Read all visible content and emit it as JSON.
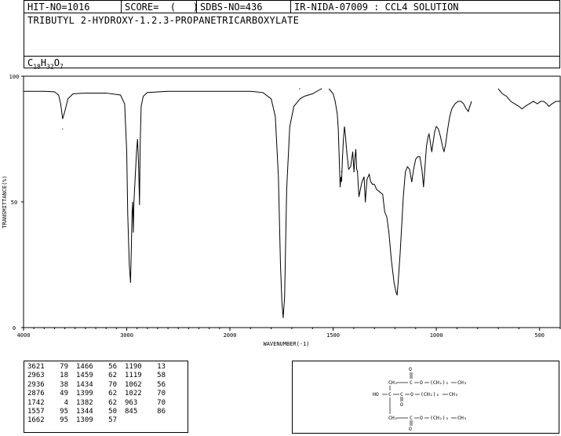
{
  "header": {
    "hit": "HIT-NO=1016",
    "score": "SCORE=  (   )",
    "sdbs": "SDBS-NO=436",
    "ir": "IR-NIDA-07009 : CCL4 SOLUTION"
  },
  "compound_name": "TRIBUTYL 2-HYDROXY-1.2.3-PROPANETRICARBOXYLATE",
  "formula": {
    "c": "C",
    "c_sub": "18",
    "h": "H",
    "h_sub": "32",
    "o": "O",
    "o_sub": "7"
  },
  "chart_data": {
    "type": "line",
    "xlabel": "WAVENUMBER(-1)",
    "ylabel": "TRANSMITTANCE(%)",
    "xlim": [
      4000,
      400
    ],
    "ylim": [
      0,
      100
    ],
    "x_ticks": [
      "4000",
      "3000",
      "2000",
      "1500",
      "1000",
      "500"
    ],
    "y_ticks": [
      "100",
      "50",
      "0"
    ],
    "series": [
      {
        "segments": [
          [
            [
              4000,
              94
            ],
            [
              3800,
              94
            ],
            [
              3700,
              93.8
            ],
            [
              3660,
              92.5
            ],
            [
              3640,
              89
            ],
            [
              3621,
              83
            ],
            [
              3600,
              86
            ],
            [
              3570,
              91
            ],
            [
              3520,
              93
            ],
            [
              3400,
              93.3
            ],
            [
              3200,
              93.3
            ],
            [
              3060,
              92.5
            ],
            [
              3020,
              89
            ],
            [
              3000,
              70
            ],
            [
              2990,
              45
            ],
            [
              2975,
              25
            ],
            [
              2963,
              18
            ],
            [
              2955,
              32
            ],
            [
              2948,
              46
            ],
            [
              2942,
              50
            ],
            [
              2936,
              38
            ],
            [
              2930,
              50
            ],
            [
              2915,
              62
            ],
            [
              2905,
              70
            ],
            [
              2895,
              75
            ],
            [
              2885,
              65
            ],
            [
              2876,
              49
            ],
            [
              2870,
              72
            ],
            [
              2860,
              88
            ],
            [
              2840,
              92
            ],
            [
              2800,
              93.5
            ],
            [
              2600,
              94
            ],
            [
              2200,
              94
            ],
            [
              1900,
              94
            ],
            [
              1840,
              93.5
            ],
            [
              1800,
              91
            ],
            [
              1780,
              84
            ],
            [
              1765,
              60
            ],
            [
              1755,
              25
            ],
            [
              1748,
              10
            ],
            [
              1742,
              4
            ],
            [
              1735,
              12
            ],
            [
              1725,
              55
            ],
            [
              1710,
              80
            ],
            [
              1690,
              88
            ],
            [
              1660,
              91
            ],
            [
              1640,
              92
            ],
            [
              1600,
              93
            ],
            [
              1557,
              95
            ]
          ],
          [
            [
              1520,
              95
            ],
            [
              1500,
              93
            ],
            [
              1490,
              90
            ],
            [
              1480,
              85
            ],
            [
              1475,
              79
            ],
            [
              1466,
              56
            ],
            [
              1462,
              60
            ],
            [
              1459,
              58
            ],
            [
              1455,
              67
            ],
            [
              1450,
              75
            ],
            [
              1445,
              80
            ],
            [
              1440,
              76
            ],
            [
              1434,
              70
            ],
            [
              1425,
              63
            ],
            [
              1415,
              64
            ],
            [
              1405,
              70
            ],
            [
              1399,
              62
            ],
            [
              1395,
              67
            ],
            [
              1390,
              71
            ],
            [
              1386,
              63
            ],
            [
              1382,
              62
            ],
            [
              1375,
              52
            ],
            [
              1368,
              55
            ],
            [
              1360,
              58
            ],
            [
              1350,
              60
            ],
            [
              1344,
              50
            ],
            [
              1336,
              59
            ],
            [
              1325,
              61
            ],
            [
              1318,
              58
            ],
            [
              1309,
              57
            ],
            [
              1300,
              57
            ],
            [
              1290,
              55
            ],
            [
              1275,
              54
            ],
            [
              1260,
              53
            ],
            [
              1250,
              46
            ],
            [
              1240,
              44
            ],
            [
              1230,
              38
            ],
            [
              1218,
              27
            ],
            [
              1205,
              18
            ],
            [
              1195,
              14
            ],
            [
              1190,
              13
            ],
            [
              1185,
              18
            ],
            [
              1175,
              30
            ],
            [
              1160,
              52
            ],
            [
              1150,
              62
            ],
            [
              1140,
              64
            ],
            [
              1130,
              63
            ],
            [
              1119,
              58
            ],
            [
              1110,
              63
            ],
            [
              1100,
              67
            ],
            [
              1090,
              68
            ],
            [
              1080,
              68
            ],
            [
              1070,
              63
            ],
            [
              1062,
              56
            ],
            [
              1055,
              64
            ],
            [
              1048,
              72
            ],
            [
              1040,
              76
            ],
            [
              1035,
              77
            ],
            [
              1028,
              73
            ],
            [
              1022,
              70
            ],
            [
              1015,
              74
            ],
            [
              1008,
              78
            ],
            [
              1000,
              80
            ],
            [
              990,
              79
            ],
            [
              980,
              76
            ],
            [
              970,
              72
            ],
            [
              963,
              70
            ],
            [
              955,
              73
            ],
            [
              945,
              79
            ],
            [
              935,
              84
            ],
            [
              925,
              87
            ],
            [
              910,
              89
            ],
            [
              895,
              90
            ],
            [
              880,
              90
            ],
            [
              868,
              89
            ],
            [
              862,
              88
            ],
            [
              855,
              87
            ],
            [
              845,
              86
            ],
            [
              838,
              88
            ],
            [
              833,
              89
            ],
            [
              830,
              90
            ]
          ],
          [
            [
              700,
              95
            ],
            [
              680,
              93
            ],
            [
              660,
              92
            ],
            [
              640,
              90
            ],
            [
              620,
              89
            ],
            [
              600,
              88
            ],
            [
              585,
              87
            ],
            [
              570,
              88
            ],
            [
              550,
              89
            ],
            [
              530,
              90
            ],
            [
              510,
              89
            ],
            [
              495,
              90
            ],
            [
              480,
              90
            ],
            [
              465,
              89
            ],
            [
              455,
              88
            ],
            [
              440,
              89
            ],
            [
              420,
              90
            ],
            [
              400,
              90
            ]
          ]
        ]
      }
    ],
    "peaks": [
      [
        3621,
        79
      ],
      [
        2963,
        18
      ],
      [
        2936,
        38
      ],
      [
        2876,
        49
      ],
      [
        1742,
        4
      ],
      [
        1557,
        95
      ],
      [
        1662,
        95
      ],
      [
        1466,
        56
      ],
      [
        1459,
        62
      ],
      [
        1434,
        70
      ],
      [
        1399,
        62
      ],
      [
        1382,
        62
      ],
      [
        1344,
        50
      ],
      [
        1309,
        57
      ],
      [
        1190,
        13
      ],
      [
        1119,
        58
      ],
      [
        1062,
        56
      ],
      [
        1022,
        70
      ],
      [
        963,
        70
      ],
      [
        845,
        86
      ]
    ]
  },
  "peak_table": [
    [
      [
        "3621",
        "79"
      ],
      [
        "1466",
        "56"
      ],
      [
        "1190",
        "13"
      ]
    ],
    [
      [
        "2963",
        "18"
      ],
      [
        "1459",
        "62"
      ],
      [
        "1119",
        "58"
      ]
    ],
    [
      [
        "2936",
        "38"
      ],
      [
        "1434",
        "70"
      ],
      [
        "1062",
        "56"
      ]
    ],
    [
      [
        "2876",
        "49"
      ],
      [
        "1399",
        "62"
      ],
      [
        "1022",
        "70"
      ]
    ],
    [
      [
        "1742",
        "4"
      ],
      [
        "1382",
        "62"
      ],
      [
        "963",
        "70"
      ]
    ],
    [
      [
        "1557",
        "95"
      ],
      [
        "1344",
        "50"
      ],
      [
        "845",
        "86"
      ]
    ],
    [
      [
        "1662",
        "95"
      ],
      [
        "1309",
        "57"
      ],
      [
        "",
        ""
      ]
    ]
  ],
  "structure": {
    "o": "O",
    "ho": "HO",
    "ch2": "CH₂",
    "c": "C",
    "top_chain": "(CH₂)₃",
    "mid_chain": "(CH₂)₃",
    "bot_chain": "(CH₂)₃",
    "ch3": "CH₃"
  }
}
